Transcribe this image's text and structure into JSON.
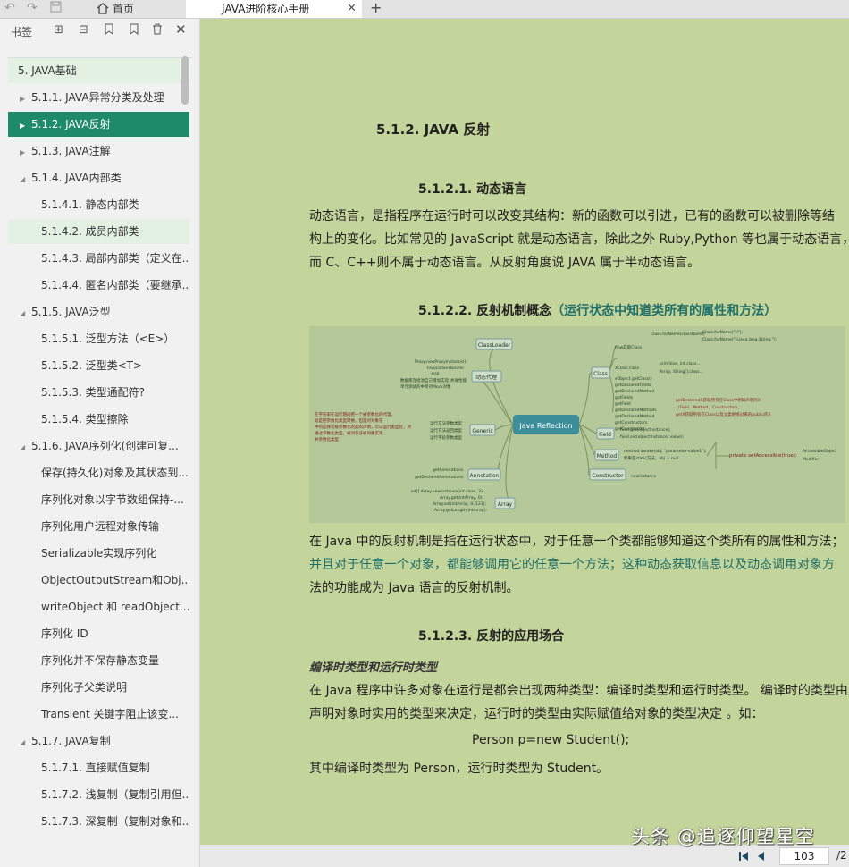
{
  "tabs": {
    "home": "首页",
    "doc": "JAVA进阶核心手册",
    "close": "✕",
    "new": "+"
  },
  "sidebar": {
    "title": "书签",
    "items": [
      {
        "label": "5. JAVA基础",
        "level": 0,
        "arrow": ""
      },
      {
        "label": "5.1.1. JAVA异常分类及处理",
        "level": 1,
        "arrow": "▶"
      },
      {
        "label": "5.1.2. JAVA反射",
        "level": 1,
        "arrow": "▶",
        "state": "selected"
      },
      {
        "label": "5.1.3. JAVA注解",
        "level": 1,
        "arrow": "▶"
      },
      {
        "label": "5.1.4. JAVA内部类",
        "level": 1,
        "arrow": "◢"
      },
      {
        "label": "5.1.4.1. 静态内部类",
        "level": 2,
        "arrow": ""
      },
      {
        "label": "5.1.4.2. 成员内部类",
        "level": 2,
        "arrow": "",
        "state": "hover"
      },
      {
        "label": "5.1.4.3. 局部内部类（定义在...",
        "level": 2,
        "arrow": ""
      },
      {
        "label": "5.1.4.4. 匿名内部类（要继承...",
        "level": 2,
        "arrow": ""
      },
      {
        "label": "5.1.5. JAVA泛型",
        "level": 1,
        "arrow": "◢"
      },
      {
        "label": "5.1.5.1. 泛型方法（<E>）",
        "level": 2,
        "arrow": ""
      },
      {
        "label": "5.1.5.2. 泛型类<T>",
        "level": 2,
        "arrow": ""
      },
      {
        "label": "5.1.5.3. 类型通配符?",
        "level": 2,
        "arrow": ""
      },
      {
        "label": "5.1.5.4. 类型擦除",
        "level": 2,
        "arrow": ""
      },
      {
        "label": "5.1.6. JAVA序列化(创建可复...",
        "level": 1,
        "arrow": "◢"
      },
      {
        "label": "保存(持久化)对象及其状态到...",
        "level": 2,
        "arrow": ""
      },
      {
        "label": "序列化对象以字节数组保持-...",
        "level": 2,
        "arrow": ""
      },
      {
        "label": "序列化用户远程对象传输",
        "level": 2,
        "arrow": ""
      },
      {
        "label": "Serializable实现序列化",
        "level": 2,
        "arrow": ""
      },
      {
        "label": "ObjectOutputStream和Obj...",
        "level": 2,
        "arrow": ""
      },
      {
        "label": "writeObject 和 readObject...",
        "level": 2,
        "arrow": ""
      },
      {
        "label": "序列化 ID",
        "level": 2,
        "arrow": ""
      },
      {
        "label": "序列化并不保存静态变量",
        "level": 2,
        "arrow": ""
      },
      {
        "label": "序列化子父类说明",
        "level": 2,
        "arrow": ""
      },
      {
        "label": "Transient  关键字阻止该变...",
        "level": 2,
        "arrow": ""
      },
      {
        "label": "5.1.7. JAVA复制",
        "level": 1,
        "arrow": "◢"
      },
      {
        "label": "5.1.7.1. 直接赋值复制",
        "level": 2,
        "arrow": ""
      },
      {
        "label": "5.1.7.2. 浅复制（复制引用但...",
        "level": 2,
        "arrow": ""
      },
      {
        "label": "5.1.7.3. 深复制（复制对象和...",
        "level": 2,
        "arrow": ""
      }
    ]
  },
  "doc": {
    "h_512": "5.1.2.  JAVA 反射",
    "h_5121": "5.1.2.1.      动态语言",
    "p1": [
      "动态语言，是指程序在运行时可以改变其结构：新的函数可以引进，已有的函数可以被删除等结",
      "构上的变化。比如常见的 JavaScript 就是动态语言，除此之外 Ruby,Python 等也属于动态语言，",
      "而 C、C++则不属于动态语言。从反射角度说 JAVA 属于半动态语言。"
    ],
    "h_5122_num": "5.1.2.2.      反射机制概念",
    "h_5122_paren": "（运行状态中知道类所有的属性和方法）",
    "p2": [
      "在  Java  中的反射机制是指在运行状态中，对于任意一个类都能够知道这个类所有的属性和方法；",
      "并且对于任意一个对象，都能够调用它的任意一个方法；这种动态获取信息以及动态调用对象方",
      "法的功能成为 Java 语言的反射机制。"
    ],
    "h_5123": "5.1.2.3.      反射的应用场合",
    "sub_title": "编译时类型和运行时类型",
    "p3": [
      "在 Java 程序中许多对象在运行是都会出现两种类型：编译时类型和运行时类型。 编译时的类型由",
      "声明对象时实用的类型来决定，运行时的类型由实际赋值给对象的类型决定 。如："
    ],
    "code": "Person p=new Student();",
    "p4": "其中编译时类型为 Person，运行时类型为 Student。"
  },
  "mindmap": {
    "center": "Java Reflection",
    "left": [
      "ClassLoader",
      "动态代理",
      "Generic",
      "Annotation",
      "Array"
    ],
    "right": [
      "Class",
      "Field",
      "Method",
      "Constructor"
    ],
    "class_leaves": [
      "how获取Class",
      "XClass.class",
      "eObject.getClass()"
    ],
    "class_methods": [
      "getDeclaredFields",
      "getDeclaredMethod",
      "getFields",
      "getField",
      "getDeclaredMethods",
      "getDeclaredMethod",
      "getConstructors",
      "getConstructor"
    ],
    "forname": [
      "Class.forName(className)",
      "Class.forName(\"[I\");",
      "Class.forName(\"[Ljava.lang.String;\");"
    ],
    "primitives": [
      "primitive, int.class...",
      "Array, String[].class..."
    ],
    "getdeclared_note": [
      "getDeclaredX获取所有在Class中明确声明的X",
      "（Field、Method、Constructor），",
      "getX获取所有在Class以及父类继承过来的public的X"
    ],
    "field_leaves": [
      "field.get(objectInstance);",
      "field.set(objectInstance, value);"
    ],
    "method_leaves": [
      "method.invoke(obj, \"parameter-value1\");",
      "如果是static方法，obj = null"
    ],
    "accessible": "private.setAccessible(true);",
    "accessible_leaves": [
      "AccessibleObject",
      "Modifier"
    ],
    "ctor_leaf": "newInstance",
    "proxy_leaves": [
      "Proxy.newProxyInstance()",
      "InvocationHandler",
      "AOP",
      "数据库连接池自己增加实现",
      "单元测试的中单对Mock对象"
    ],
    "generic_note": [
      "在字符串在运行期间把一个被参数化的代理，",
      "就是把参数化类型转换，但是对对象在",
      "中的这样可被参数化的类的声明，可以运行类型化，对",
      "通过参数化类型，被问答该被对象实现",
      "并参数化类型"
    ],
    "generic_leaves": [
      "运行方法参数类型",
      "运行方法返回类型",
      "运行字段参数类型"
    ],
    "annotation_leaves": [
      "getAnnotations",
      "getDeclaredAnnotations"
    ],
    "array_leaves": [
      "int[] Array.newInstance(int.class, 3);",
      "Array.get(intArray, 0);",
      "Array.set(intArray, 0, 123);",
      "Array.getLength(intArray);"
    ],
    "proxy_side": "并发性能"
  },
  "pager": {
    "page": "103",
    "total": "/2"
  },
  "watermark": "头条 @追逐仰望星空",
  "colors": {
    "accent": "#1e8a6a",
    "page_bg": "#c4d59b",
    "teal_text": "#1f6f6a",
    "center_node": "#3c8f9a"
  }
}
